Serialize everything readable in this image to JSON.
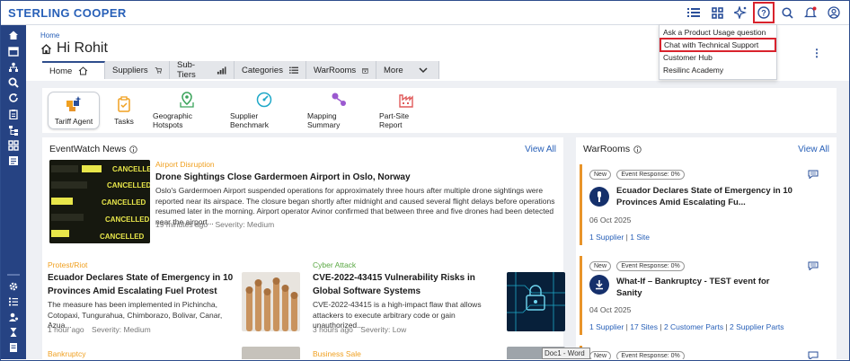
{
  "app": {
    "brand": "STERLING COOPER"
  },
  "header": {
    "breadcrumb": "Home",
    "greeting": "Hi Rohit"
  },
  "tabs": [
    {
      "label": "Home",
      "icon": "home-icon"
    },
    {
      "label": "Suppliers",
      "icon": "supplier-icon"
    },
    {
      "label": "Sub-Tiers",
      "icon": "subtier-icon"
    },
    {
      "label": "Categories",
      "icon": "list-icon"
    },
    {
      "label": "WarRooms",
      "icon": "calendar-icon"
    },
    {
      "label": "More",
      "icon": "chevron-down-icon"
    }
  ],
  "quick_links": [
    {
      "label": "Tariff Agent",
      "icon": "tariff-agent-icon"
    },
    {
      "label": "Tasks",
      "icon": "clipboard-icon"
    },
    {
      "label": "Geographic Hotspots",
      "icon": "map-pin-icon"
    },
    {
      "label": "Supplier Benchmark",
      "icon": "gauge-icon"
    },
    {
      "label": "Mapping Summary",
      "icon": "mapping-icon"
    },
    {
      "label": "Part-Site Report",
      "icon": "factory-icon"
    }
  ],
  "help_menu": {
    "items": [
      "Ask a Product Usage question",
      "Chat with Technical Support",
      "Customer Hub",
      "Resilinc Academy"
    ]
  },
  "news": {
    "title": "EventWatch News",
    "view_all": "View All",
    "featured": {
      "tag": "Airport Disruption",
      "headline": "Drone Sightings Close Gardermoen Airport in Oslo, Norway",
      "summary": "Oslo's Gardermoen Airport suspended operations for approximately three hours after multiple drone sightings were reported near its airspace. The closure began shortly after midnight and caused several flight delays before operations resumed later in the morning. Airport operator Avinor confirmed that between three and five drones had been detected near the airport...",
      "time": "19 minutes ago",
      "severity": "Severity: Medium",
      "thumb_text": [
        "CANCELLED",
        "CANCELLED",
        "CANCELLED",
        "CANCELLED",
        "CANCELLED"
      ]
    },
    "items": [
      {
        "tag": "Protest/Riot",
        "headline": "Ecuador Declares State of Emergency in 10 Provinces Amid Escalating Fuel Protest",
        "summary": "The measure has been implemented in Pichincha, Cotopaxi, Tungurahua, Chimborazo, Bolivar, Canar, Azua...",
        "time": "1 hour ago",
        "severity": "Severity: Medium"
      },
      {
        "tag": "Cyber Attack",
        "headline": "CVE-2022-43415 Vulnerability Risks in Global Software Systems",
        "summary": "CVE-2022-43415 is a high-impact flaw that allows attackers to execute arbitrary code or gain unauthorized...",
        "time": "3 hours ago",
        "severity": "Severity: Low"
      }
    ],
    "more_tags": [
      "Bankruptcy",
      "Business Sale"
    ]
  },
  "warrooms": {
    "title": "WarRooms",
    "view_all": "View All",
    "items": [
      {
        "badge_new": "New",
        "badge_response": "Event Response: 0%",
        "title": "Ecuador Declares State of Emergency in 10 Provinces Amid Escalating Fu...",
        "date": "06 Oct 2025",
        "links": [
          "1 Supplier",
          "1 Site"
        ]
      },
      {
        "badge_new": "New",
        "badge_response": "Event Response: 0%",
        "title": "What-If – Bankruptcy - TEST event for Sanity",
        "date": "04 Oct 2025",
        "links": [
          "1 Supplier",
          "17 Sites",
          "2 Customer Parts",
          "2 Supplier Parts"
        ]
      },
      {
        "badge_new": "New",
        "badge_response": "Event Response: 0%"
      }
    ]
  },
  "taskbar_tooltip": "Doc1 - Word",
  "colors": {
    "brand": "#2860b8",
    "sidebar": "#264383",
    "accent_orange": "#e8942a",
    "highlight_red": "#d9232d",
    "tag_orange": "#f0a020",
    "tag_green": "#5aa843"
  }
}
